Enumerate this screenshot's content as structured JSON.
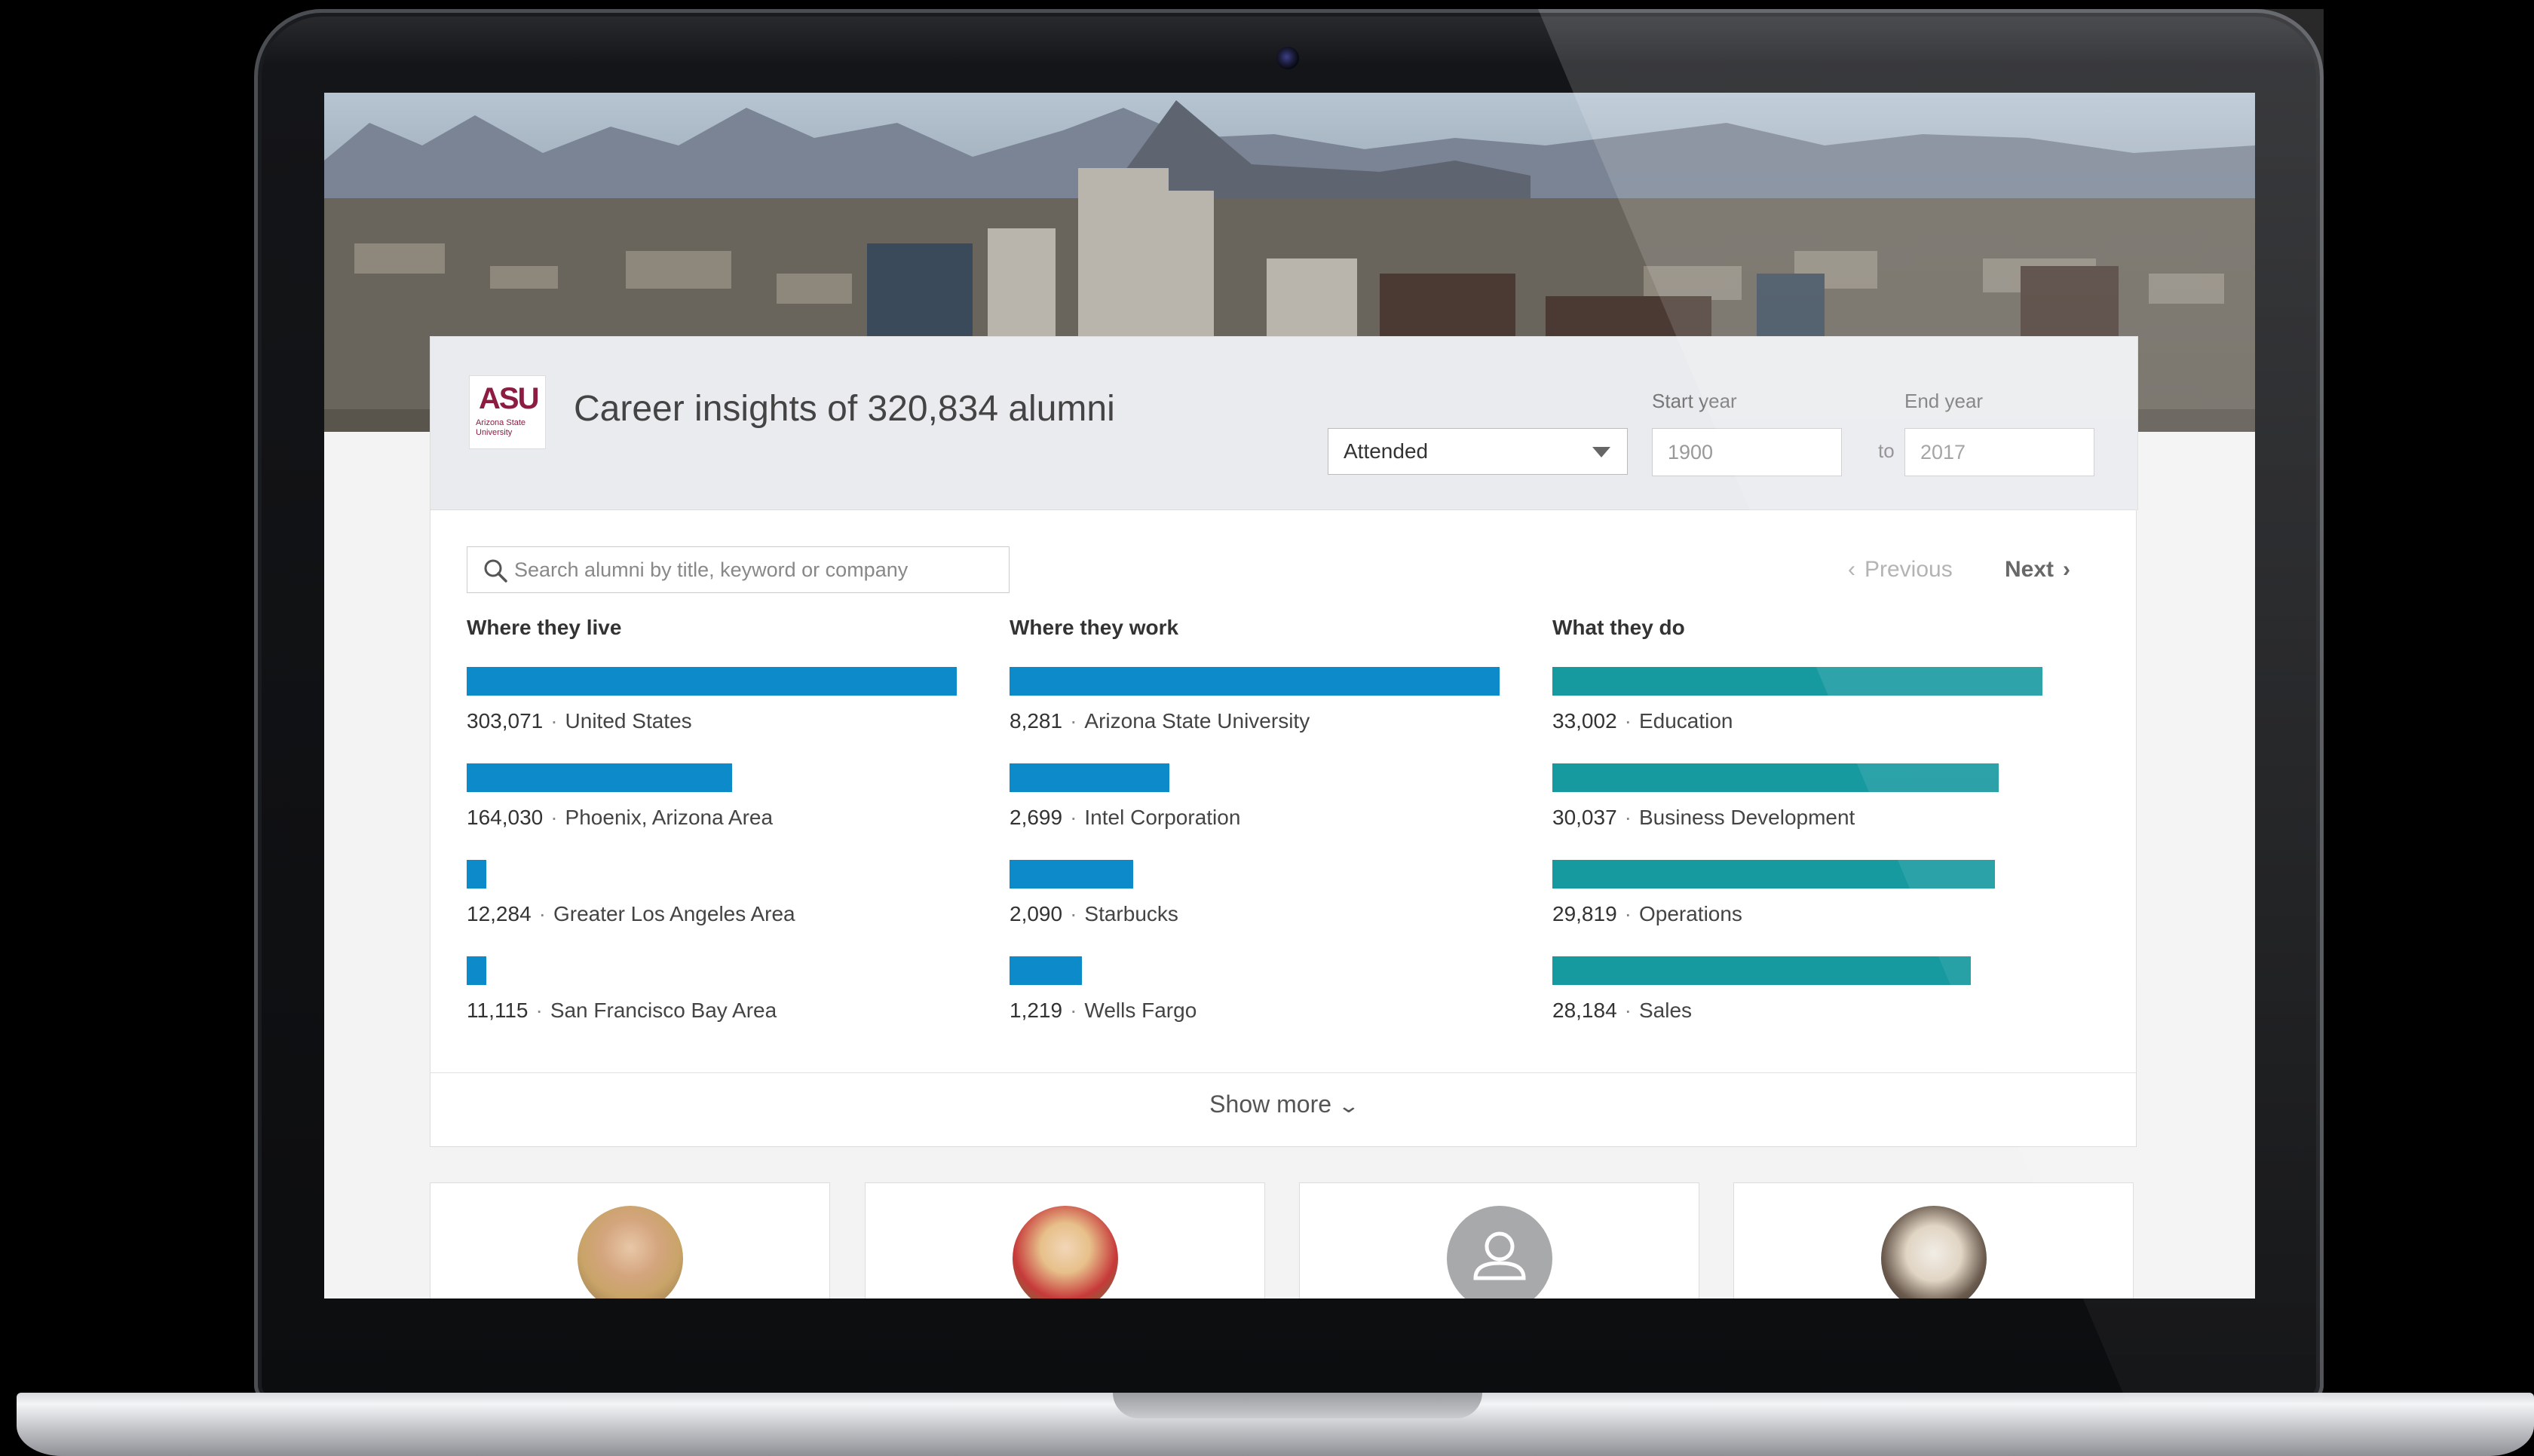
{
  "header": {
    "logo_text": "ASU",
    "logo_subtext": "Arizona State University",
    "title": "Career insights of 320,834 alumni",
    "status_select": "Attended",
    "start_year_label": "Start year",
    "start_year_value": "1900",
    "to_label": "to",
    "end_year_label": "End year",
    "end_year_value": "2017"
  },
  "search": {
    "placeholder": "Search alumni by title, keyword or company"
  },
  "pager": {
    "previous": "Previous",
    "next": "Next"
  },
  "colors": {
    "blue_bar": "#0c8ac9",
    "teal_bar": "#16999f"
  },
  "columns": [
    {
      "title": "Where they live",
      "max": 303071,
      "items": [
        {
          "count": "303,071",
          "value": 303071,
          "label": "United States"
        },
        {
          "count": "164,030",
          "value": 164030,
          "label": "Phoenix, Arizona Area"
        },
        {
          "count": "12,284",
          "value": 12284,
          "label": "Greater Los Angeles Area"
        },
        {
          "count": "11,115",
          "value": 11115,
          "label": "San Francisco Bay Area"
        }
      ]
    },
    {
      "title": "Where they work",
      "max": 8281,
      "items": [
        {
          "count": "8,281",
          "value": 8281,
          "label": "Arizona State University"
        },
        {
          "count": "2,699",
          "value": 2699,
          "label": "Intel Corporation"
        },
        {
          "count": "2,090",
          "value": 2090,
          "label": "Starbucks"
        },
        {
          "count": "1,219",
          "value": 1219,
          "label": "Wells Fargo"
        }
      ]
    },
    {
      "title": "What they do",
      "max": 33002,
      "items": [
        {
          "count": "33,002",
          "value": 33002,
          "label": "Education"
        },
        {
          "count": "30,037",
          "value": 30037,
          "label": "Business Development"
        },
        {
          "count": "29,819",
          "value": 29819,
          "label": "Operations"
        },
        {
          "count": "28,184",
          "value": 28184,
          "label": "Sales"
        }
      ]
    }
  ],
  "show_more": "Show more",
  "profiles": [
    {
      "avatar": "photo-avatar-blonde"
    },
    {
      "avatar": "photo-avatar-red-top"
    },
    {
      "avatar": "default-person-icon"
    },
    {
      "avatar": "photo-avatar-white-shirt"
    }
  ]
}
